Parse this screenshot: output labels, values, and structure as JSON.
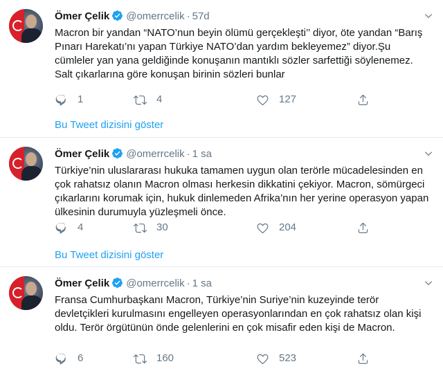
{
  "tweets": [
    {
      "name": "Ömer Çelik",
      "handle": "@omerrcelik",
      "dot": "·",
      "time": "57d",
      "text": "Macron bir yandan “NATO’nun beyin ölümü gerçekleşti’’ diyor, öte yandan “Barış Pınarı Harekatı’nı yapan Türkiye NATO’dan yardım bekleyemez” diyor.Şu cümleler yan yana geldiğinde konuşanın mantıklı sözler sarfettiği söylenemez. Salt çıkarlarına göre konuşan birinin sözleri bunlar",
      "replies": "1",
      "retweets": "4",
      "likes": "127",
      "thread_link": "Bu Tweet dizisini göster"
    },
    {
      "name": "Ömer Çelik",
      "handle": "@omerrcelik",
      "dot": "·",
      "time": "1 sa",
      "text": "Türkiye’nin uluslararası hukuka tamamen uygun olan terörle mücadelesinden en çok rahatsız olanın Macron olması herkesin dikkatini çekiyor. Macron, sömürgeci çıkarlarını korumak için, hukuk dinlemeden Afrika’nın her yerine operasyon yapan ülkesinin durumuyla yüzleşmeli önce.",
      "replies": "4",
      "retweets": "30",
      "likes": "204",
      "thread_link": "Bu Tweet dizisini göster"
    },
    {
      "name": "Ömer Çelik",
      "handle": "@omerrcelik",
      "dot": "·",
      "time": "1 sa",
      "text": "Fransa Cumhurbaşkanı Macron, Türkiye’nin Suriye’nin kuzeyinde terör devletçikleri kurulmasını engelleyen operasyonlarından en çok rahatsız olan kişi oldu. Terör örgütünün önde gelenlerini en çok misafir eden kişi de Macron.",
      "replies": "6",
      "retweets": "160",
      "likes": "523"
    }
  ],
  "icons": {
    "verified": "verified-badge-icon",
    "more": "chevron-down-icon",
    "reply": "reply-icon",
    "retweet": "retweet-icon",
    "like": "heart-icon",
    "share": "share-icon"
  },
  "colors": {
    "accent": "#1da1f2",
    "muted": "#657786",
    "text": "#14171a",
    "divider": "#e6ecf0"
  }
}
